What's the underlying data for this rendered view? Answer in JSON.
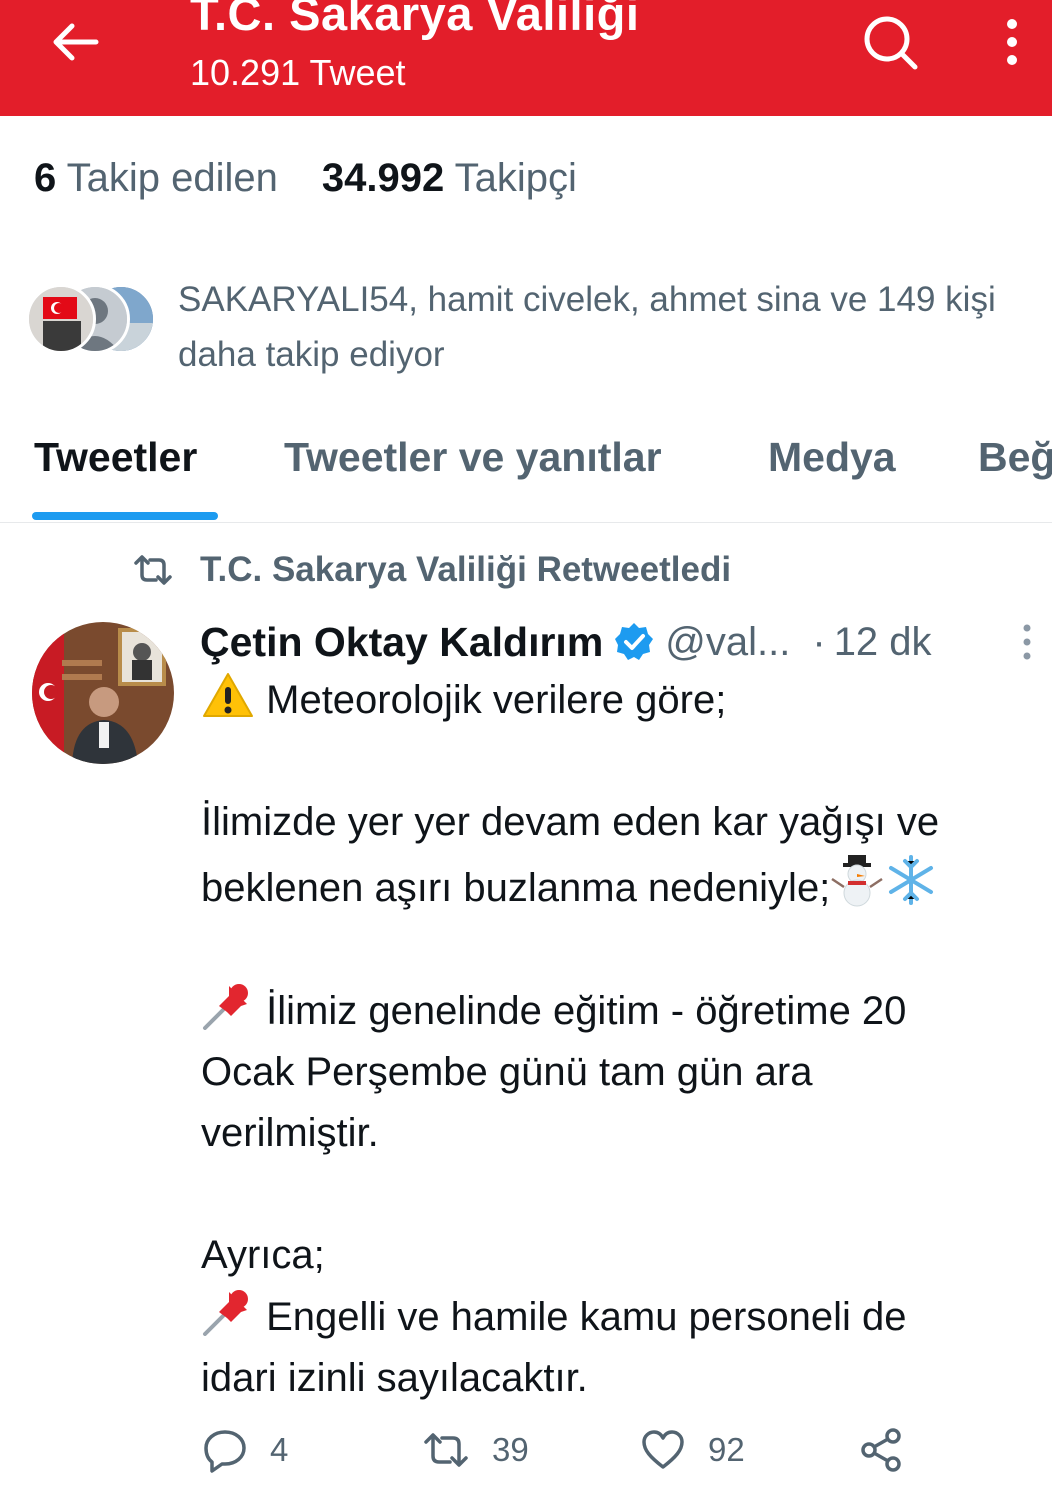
{
  "header": {
    "title": "T.C. Sakarya Valiliği",
    "subtitle": "10.291 Tweet",
    "icons": [
      "back-arrow-icon",
      "search-icon",
      "more-vertical-icon"
    ],
    "background_color": "#e31e2a"
  },
  "stats": {
    "following_count": "6",
    "following_label": "Takip edilen",
    "followers_count": "34.992",
    "followers_label": "Takipçi"
  },
  "followed_by": {
    "text": "SAKARYALI54, hamit civelek, ahmet sina ve 149 kişi daha takip ediyor",
    "avatars": [
      "follower-avatar-1",
      "follower-avatar-2",
      "follower-avatar-3"
    ]
  },
  "tabs": [
    {
      "label": "Tweetler",
      "active": true
    },
    {
      "label": "Tweetler ve yanıtlar",
      "active": false
    },
    {
      "label": "Medya",
      "active": false
    },
    {
      "label": "Beğ",
      "active": false
    }
  ],
  "accent_color": "#1d9bf0",
  "tweet": {
    "retweet_label": "T.C. Sakarya Valiliği Retweetledi",
    "author": "Çetin Oktay Kaldırım",
    "verified": true,
    "handle": "@val...",
    "separator": "·",
    "time": "12 dk",
    "lines": [
      "Meteorolojik verilere göre;",
      "İlimizde yer yer devam eden kar yağışı ve",
      "beklenen aşırı buzlanma nedeniyle;",
      "İlimiz genelinde eğitim - öğretime 20",
      "Ocak Perşembe günü tam gün ara",
      "verilmiştir.",
      "Ayrıca;",
      "Engelli ve hamile kamu personeli de",
      "idari izinli sayılacaktır."
    ],
    "emojis": [
      "warning-icon",
      "snowman-icon",
      "snowflake-icon",
      "pushpin-icon",
      "pushpin-icon"
    ],
    "actions": {
      "replies": "4",
      "retweets": "39",
      "likes": "92"
    }
  }
}
